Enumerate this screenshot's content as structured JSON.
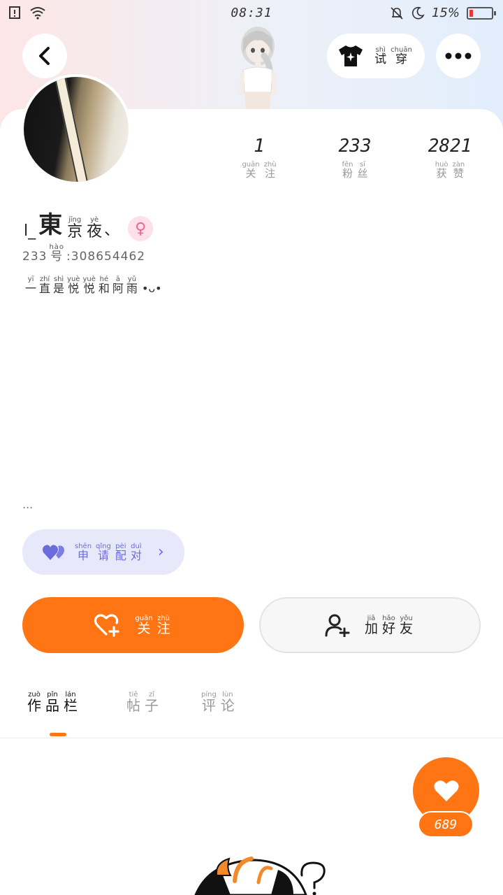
{
  "status_bar": {
    "time": "08:31",
    "battery": "15%",
    "battery_level": 0.15
  },
  "header": {
    "tryon": {
      "pinyin": [
        "shì",
        "chuān"
      ],
      "chars": [
        "试",
        "穿"
      ],
      "icon": "tshirt-sparkle-icon"
    }
  },
  "stats": [
    {
      "value": "1",
      "pinyin": [
        "guān",
        "zhù"
      ],
      "chars": [
        "关",
        "注"
      ]
    },
    {
      "value": "233",
      "pinyin": [
        "fěn",
        "sī"
      ],
      "chars": [
        "粉",
        "丝"
      ]
    },
    {
      "value": "2821",
      "pinyin": [
        "huò",
        "zàn"
      ],
      "chars": [
        "获",
        "赞"
      ]
    }
  ],
  "profile": {
    "name_prefix": "l_",
    "name_main": "東",
    "name_pinyin": [
      "jīng",
      "yè"
    ],
    "name_chars": [
      "京",
      "夜"
    ],
    "name_suffix": "、",
    "uid_prefix": "233",
    "uid_pinyin": "hào",
    "uid_char": "号",
    "uid_value": ":308654462",
    "bio_pinyin": [
      "yī",
      "zhí",
      "shì",
      "yuè",
      "yuè",
      "hé",
      "ā",
      "yǔ"
    ],
    "bio_chars": [
      "一",
      "直",
      "是",
      "悦",
      "悦",
      "和",
      "阿",
      "雨"
    ],
    "bio_emoticon": "•ᴗ•",
    "more": "..."
  },
  "match_button": {
    "pinyin": [
      "shēn",
      "qǐng",
      "pèi",
      "duì"
    ],
    "chars": [
      "申",
      "请",
      "配",
      "对"
    ],
    "chevron": "›"
  },
  "follow_button": {
    "pinyin": [
      "guān",
      "zhù"
    ],
    "chars": [
      "关",
      "注"
    ]
  },
  "friend_button": {
    "pinyin": [
      "jiā",
      "hǎo",
      "yǒu"
    ],
    "chars": [
      "加",
      "好",
      "友"
    ]
  },
  "tabs": [
    {
      "pinyin": [
        "zuò",
        "pǐn",
        "lán"
      ],
      "chars": [
        "作",
        "品",
        "栏"
      ],
      "active": true
    },
    {
      "pinyin": [
        "tiě",
        "zǐ"
      ],
      "chars": [
        "帖",
        "子"
      ],
      "active": false
    },
    {
      "pinyin": [
        "píng",
        "lùn"
      ],
      "chars": [
        "评",
        "论"
      ],
      "active": false
    }
  ],
  "like": {
    "count": "689"
  },
  "colors": {
    "accent": "#ff7514",
    "match": "#6a6bdc",
    "gender": "#f06292"
  }
}
